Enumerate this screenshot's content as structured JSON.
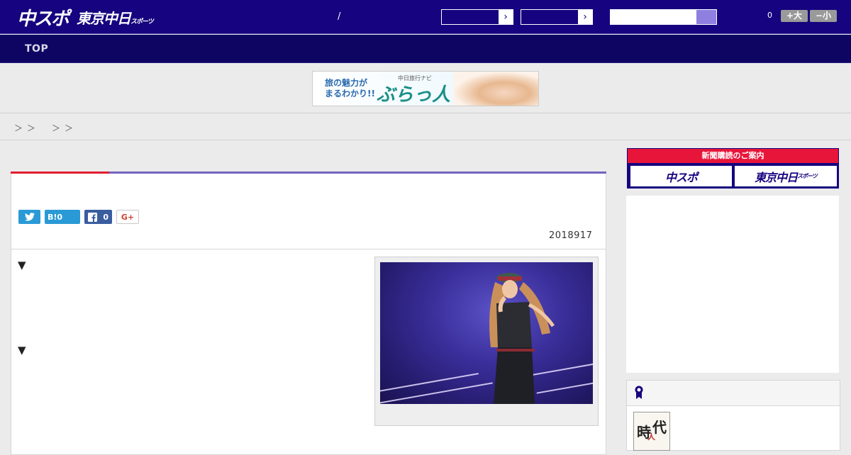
{
  "header": {
    "logo_main": "中スポ",
    "logo_sub": "東京中日",
    "logo_sub_small": "スポーツ",
    "separator": "/",
    "select_arrow_1": "›",
    "select_arrow_2": "›",
    "font_size_count": "0",
    "font_bigger_label": "+大",
    "font_smaller_label": "−小"
  },
  "nav": {
    "items": [
      {
        "label": "TOP"
      }
    ]
  },
  "ad_banner": {
    "line1": "旅の魅力が",
    "line2": "まるわかり!!",
    "small": "中日旅行ナビ",
    "brand": "ぶらっ人"
  },
  "breadcrumb": {
    "items": [
      "＞",
      "＞",
      "＞",
      "＞"
    ]
  },
  "article": {
    "share": {
      "hatena_label": "B!",
      "hatena_count": "0",
      "facebook_count": "0",
      "gplus_label": "G+"
    },
    "date": "2018917",
    "bullets": [
      "▼",
      "▼"
    ]
  },
  "sidebar": {
    "subscribe_header": "新聞購読のご案内",
    "subscribe_btn1": "中スポ",
    "subscribe_btn2": "東京中日",
    "subscribe_btn2_small": "スポーツ",
    "book_title_1": "時",
    "book_title_2": "代",
    "book_title_small": "人"
  },
  "colors": {
    "header_bg": "#16037f",
    "nav_bg": "#0e0462",
    "accent_red": "#e01c2f",
    "accent_purple": "#7463bf",
    "twitter": "#2a9ad6",
    "facebook": "#3a5da0"
  }
}
